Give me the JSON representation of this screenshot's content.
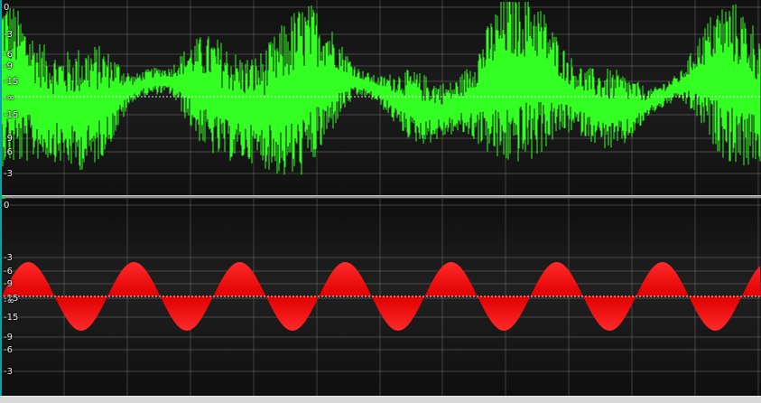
{
  "viewer": {
    "tracks": [
      {
        "name": "track-1",
        "waveform_color": "#33ff22",
        "waveform_kind": "noisy-audio",
        "db_labels": [
          {
            "text": "0",
            "db": 0,
            "half": "upper"
          },
          {
            "text": "-3",
            "db": -3,
            "half": "upper"
          },
          {
            "text": "-6",
            "db": -6,
            "half": "upper"
          },
          {
            "text": "-9",
            "db": -9,
            "half": "upper"
          },
          {
            "text": "-15",
            "db": -15,
            "half": "upper"
          },
          {
            "text": "-∞",
            "db": null,
            "half": "center"
          },
          {
            "text": "-15",
            "db": -15,
            "half": "lower"
          },
          {
            "text": "-9",
            "db": -9,
            "half": "lower"
          },
          {
            "text": "-6",
            "db": -6,
            "half": "lower"
          },
          {
            "text": "-3",
            "db": -3,
            "half": "lower"
          }
        ]
      },
      {
        "name": "track-2",
        "waveform_color": "#ff1a1a",
        "waveform_kind": "sine",
        "sine_cycles": 7.2,
        "peak_db": -9,
        "db_labels": [
          {
            "text": "0",
            "db": 0,
            "half": "upper"
          },
          {
            "text": "-3",
            "db": -3,
            "half": "upper"
          },
          {
            "text": "-6",
            "db": -6,
            "half": "upper"
          },
          {
            "text": "-9",
            "db": -9,
            "half": "upper"
          },
          {
            "text": "-15",
            "db": -15,
            "half": "upper"
          },
          {
            "text": "-∞",
            "db": null,
            "half": "center"
          },
          {
            "text": "-15",
            "db": -15,
            "half": "lower"
          },
          {
            "text": "-9",
            "db": -9,
            "half": "lower"
          },
          {
            "text": "-6",
            "db": -6,
            "half": "lower"
          },
          {
            "text": "-3",
            "db": -3,
            "half": "lower"
          }
        ]
      }
    ],
    "grid_color": "#8a8a8a",
    "center_line_color": "#ffffff",
    "playhead_marker_color": "#18e018"
  }
}
